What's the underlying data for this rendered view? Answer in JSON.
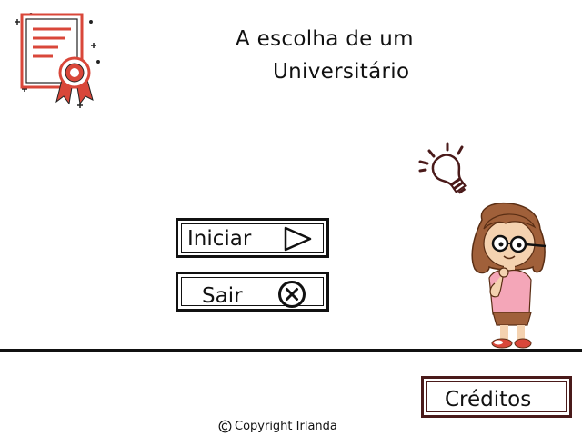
{
  "title": {
    "line1": "A escolha de um",
    "line2": "Universitário"
  },
  "menu": {
    "start_label": "Iniciar",
    "exit_label": "Sair",
    "credits_label": "Créditos"
  },
  "footer": {
    "copyright": "Copyright Irlanda"
  },
  "colors": {
    "accent_red": "#d9473a",
    "dark_brown": "#4a1a1a",
    "hair_brown": "#a0603a",
    "skin": "#f4d2b0",
    "shirt_pink": "#f4a6b8"
  },
  "icons": {
    "start": "play-triangle-icon",
    "exit": "circle-x-icon",
    "copyright": "copyright-symbol-icon",
    "decor_certificate": "certificate-icon",
    "decor_bulb": "lightbulb-icon"
  }
}
